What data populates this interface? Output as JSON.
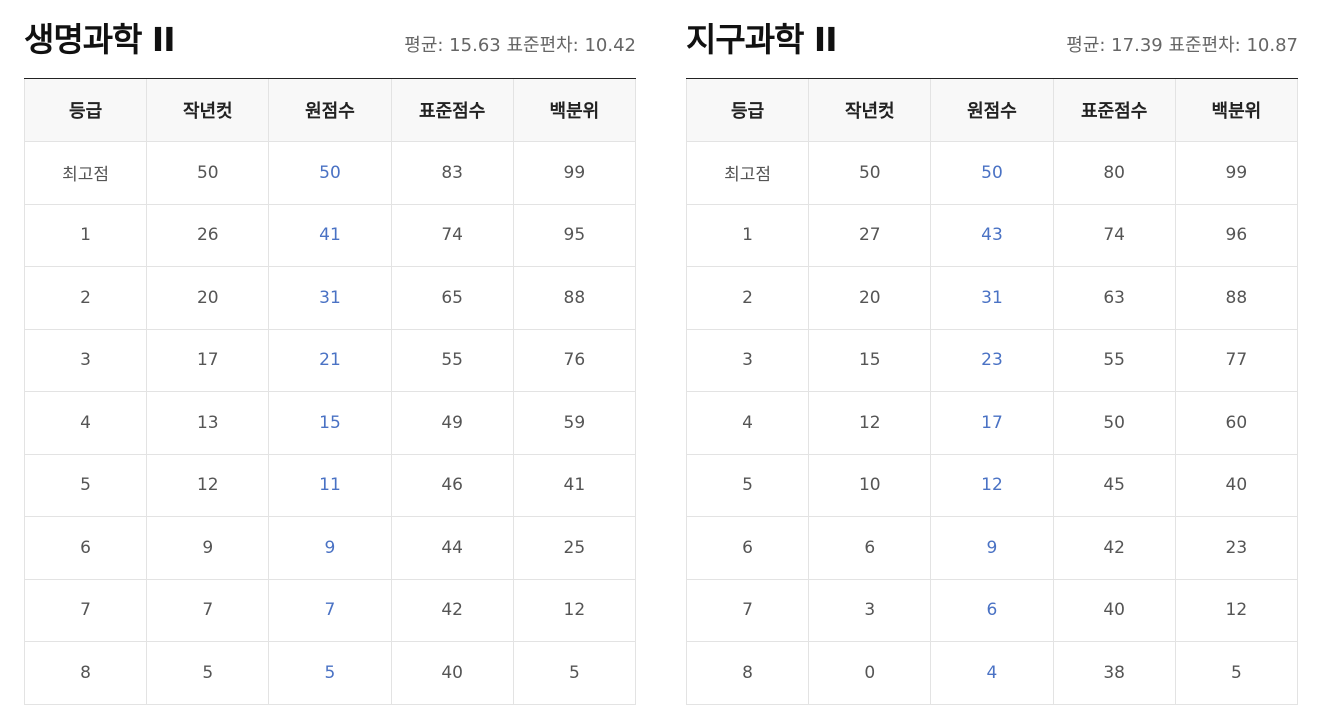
{
  "columns": [
    "등급",
    "작년컷",
    "원점수",
    "표준점수",
    "백분위"
  ],
  "tables": [
    {
      "title": "생명과학 II",
      "stats": "평균: 15.63 표준편차: 10.42",
      "rows": [
        [
          "최고점",
          "50",
          "50",
          "83",
          "99"
        ],
        [
          "1",
          "26",
          "41",
          "74",
          "95"
        ],
        [
          "2",
          "20",
          "31",
          "65",
          "88"
        ],
        [
          "3",
          "17",
          "21",
          "55",
          "76"
        ],
        [
          "4",
          "13",
          "15",
          "49",
          "59"
        ],
        [
          "5",
          "12",
          "11",
          "46",
          "41"
        ],
        [
          "6",
          "9",
          "9",
          "44",
          "25"
        ],
        [
          "7",
          "7",
          "7",
          "42",
          "12"
        ],
        [
          "8",
          "5",
          "5",
          "40",
          "5"
        ]
      ]
    },
    {
      "title": "지구과학 II",
      "stats": "평균: 17.39 표준편차: 10.87",
      "rows": [
        [
          "최고점",
          "50",
          "50",
          "80",
          "99"
        ],
        [
          "1",
          "27",
          "43",
          "74",
          "96"
        ],
        [
          "2",
          "20",
          "31",
          "63",
          "88"
        ],
        [
          "3",
          "15",
          "23",
          "55",
          "77"
        ],
        [
          "4",
          "12",
          "17",
          "50",
          "60"
        ],
        [
          "5",
          "10",
          "12",
          "45",
          "40"
        ],
        [
          "6",
          "6",
          "9",
          "42",
          "23"
        ],
        [
          "7",
          "3",
          "6",
          "40",
          "12"
        ],
        [
          "8",
          "0",
          "4",
          "38",
          "5"
        ]
      ]
    }
  ],
  "colors": {
    "raw_score_text": "#4a72c4",
    "header_bg": "#f8f8f8",
    "title": "#111111"
  }
}
